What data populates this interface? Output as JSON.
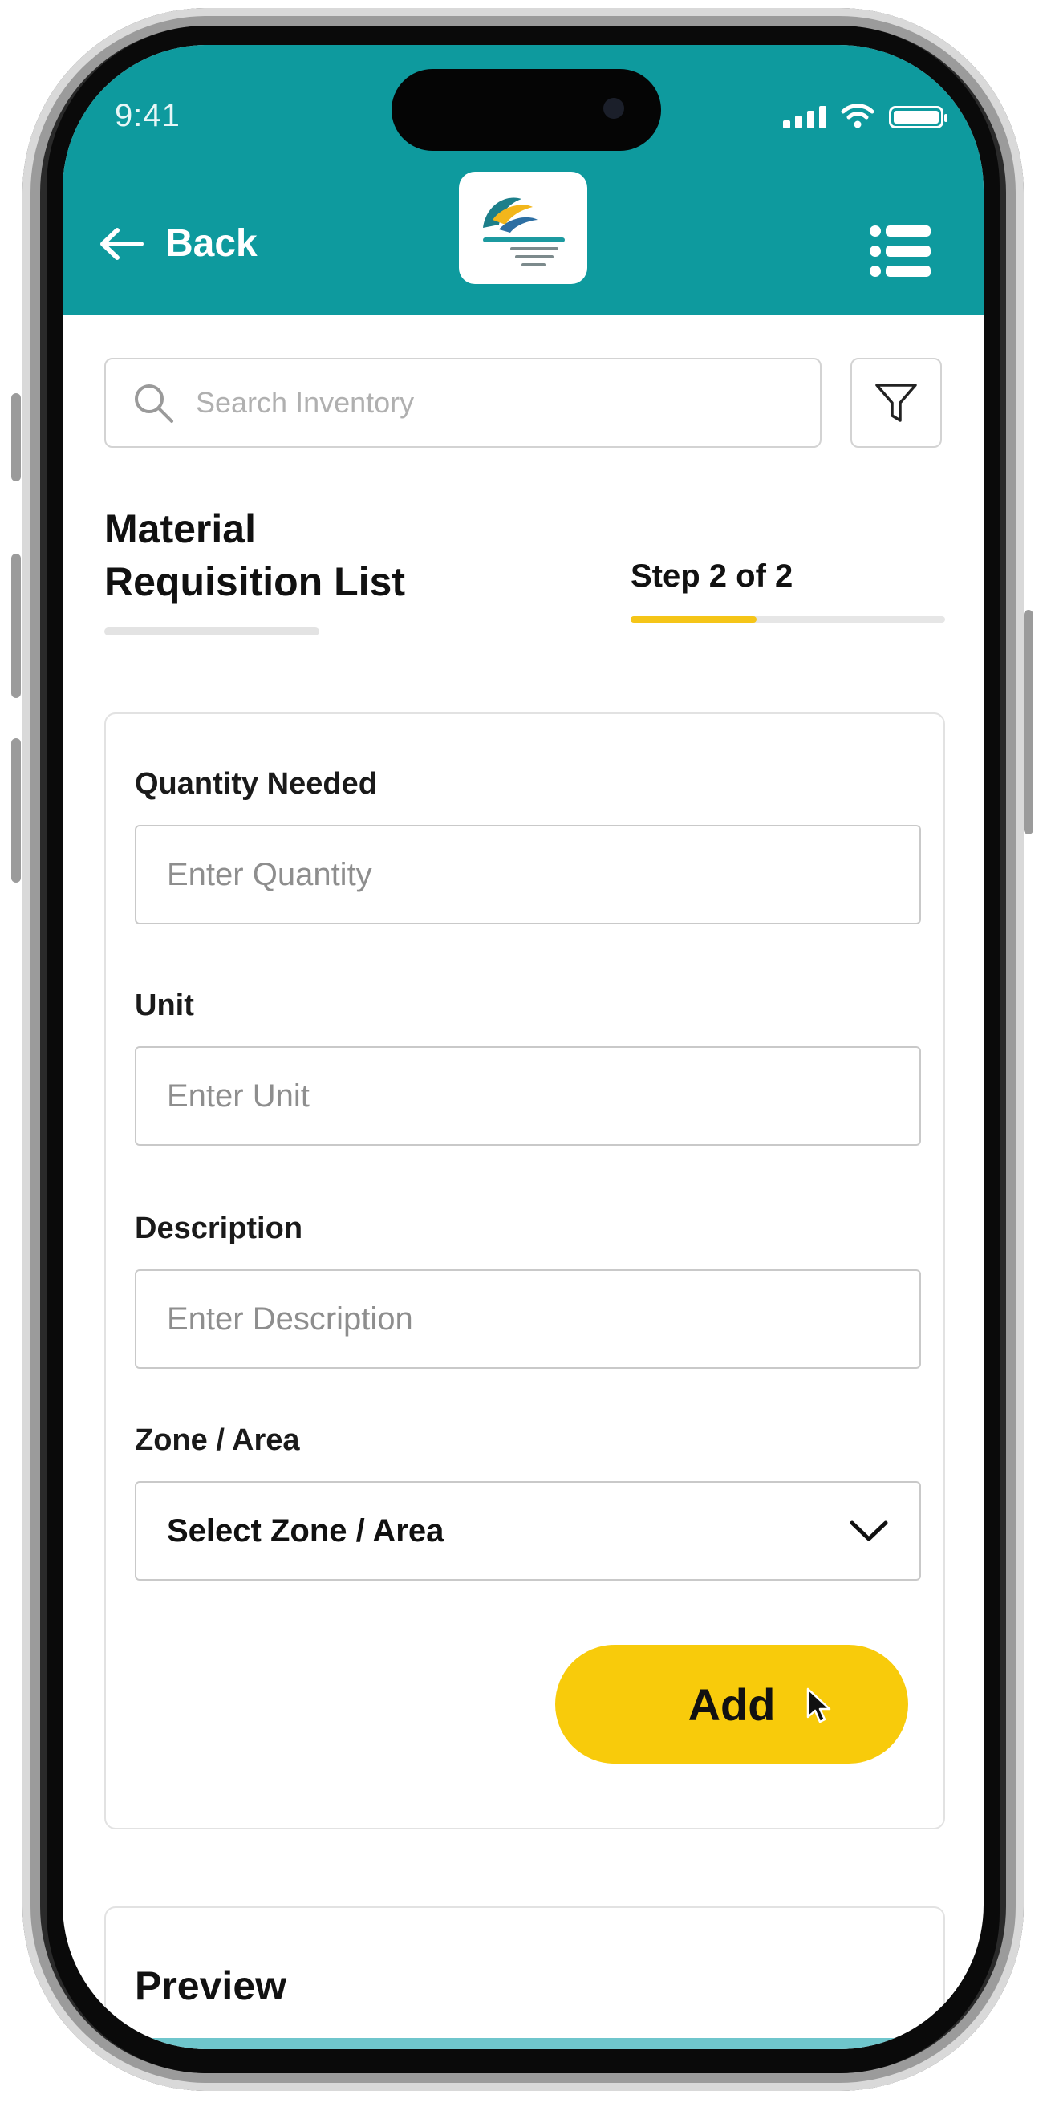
{
  "status_bar": {
    "time": "9:41"
  },
  "header": {
    "back_label": "Back",
    "logo_icon": "company-logo",
    "menu_icon": "list-menu-icon",
    "color": "#0e9a9e"
  },
  "search": {
    "placeholder": "Search Inventory",
    "filter_icon": "filter-icon"
  },
  "page": {
    "title_line1": "Material",
    "title_line2": "Requisition List",
    "step_label": "Step 2 of 2",
    "step_progress_fraction": 0.4
  },
  "form": {
    "quantity_label": "Quantity Needed",
    "quantity_placeholder": "Enter Quantity",
    "unit_label": "Unit",
    "unit_placeholder": "Enter Unit",
    "description_label": "Description",
    "description_placeholder": "Enter Description",
    "zone_label": "Zone / Area",
    "zone_selected": "Select Zone / Area",
    "add_label": "Add",
    "add_color": "#f8cb0b"
  },
  "preview": {
    "title": "Preview"
  }
}
